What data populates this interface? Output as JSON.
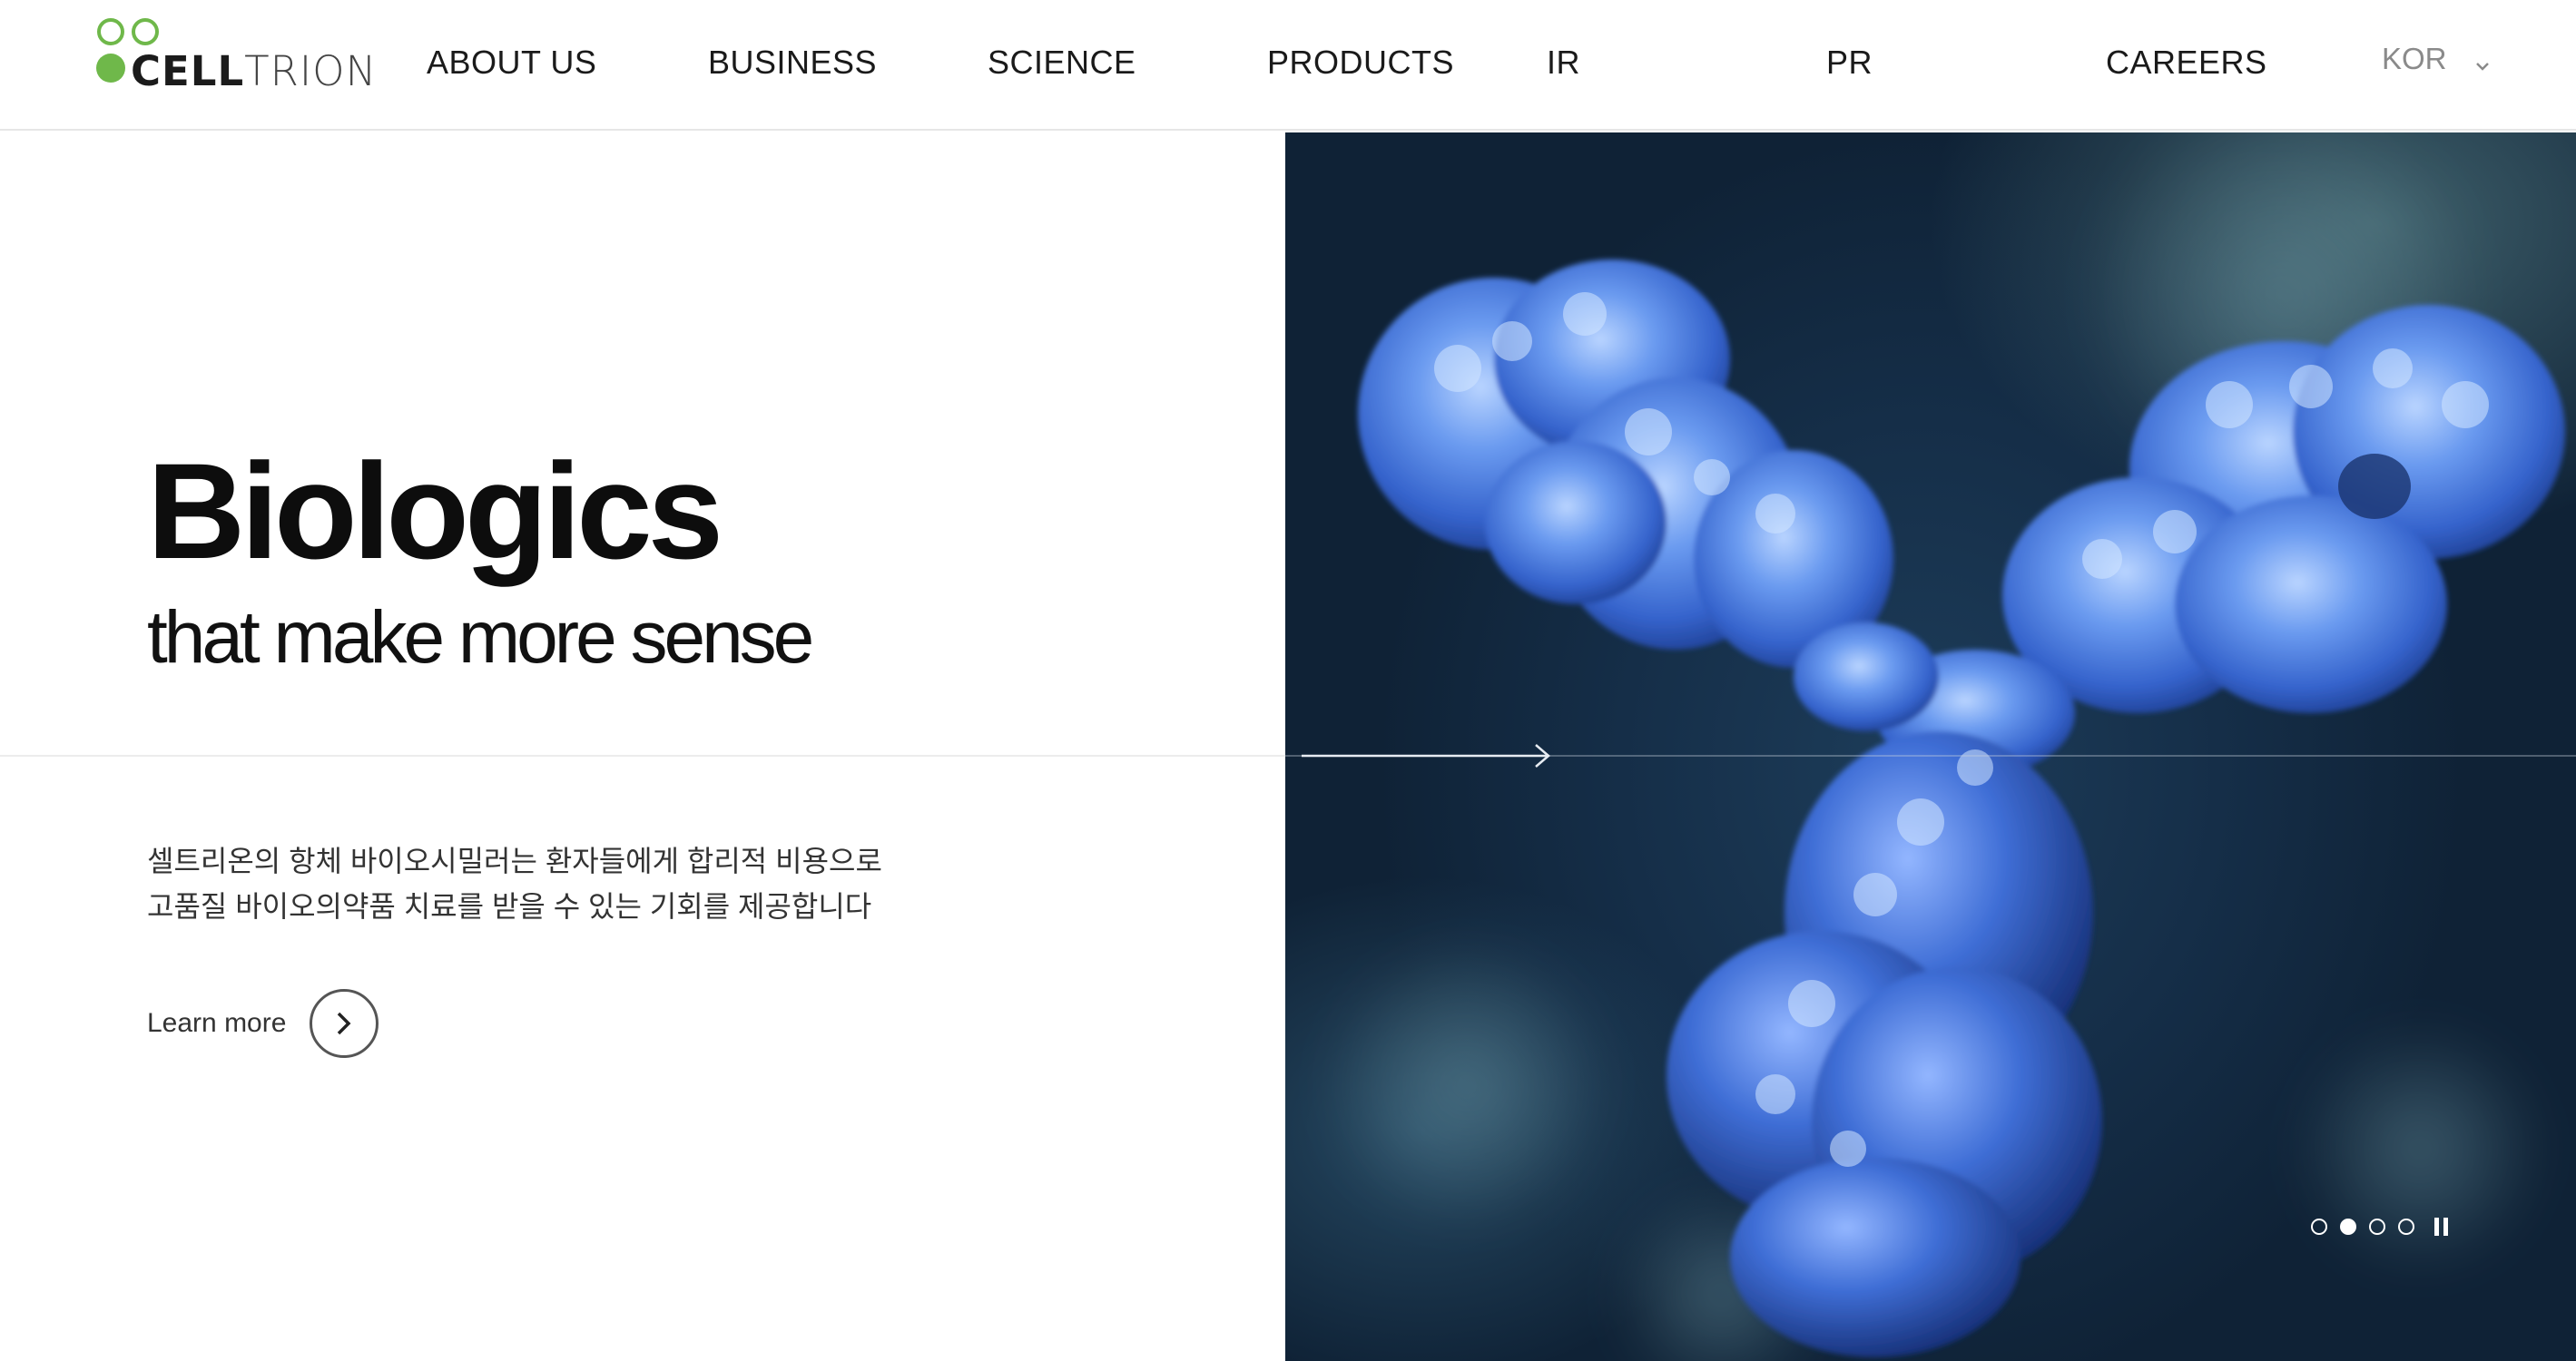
{
  "brand": {
    "name_bold": "CELL",
    "name_light": "TRION",
    "green": "#6fb84a",
    "dark": "#1b1b1b"
  },
  "nav": {
    "items": [
      "ABOUT US",
      "BUSINESS",
      "SCIENCE",
      "PRODUCTS",
      "IR",
      "PR",
      "CAREERS"
    ],
    "language": "KOR",
    "language_icon": "chevron-down-icon"
  },
  "hero": {
    "title": "Biologics",
    "subtitle": "that make more sense",
    "description": [
      "셀트리온의 항체 바이오시밀러는 환자들에게 합리적 비용으로",
      "고품질 바이오의약품 치료를 받을 수 있는 기회를 제공합니다"
    ],
    "cta_label": "Learn more",
    "cta_icon": "chevron-right-icon",
    "image_subject": "antibody molecule illustration"
  },
  "slider": {
    "total": 4,
    "active_index": 1,
    "pause_icon": "pause-icon"
  }
}
